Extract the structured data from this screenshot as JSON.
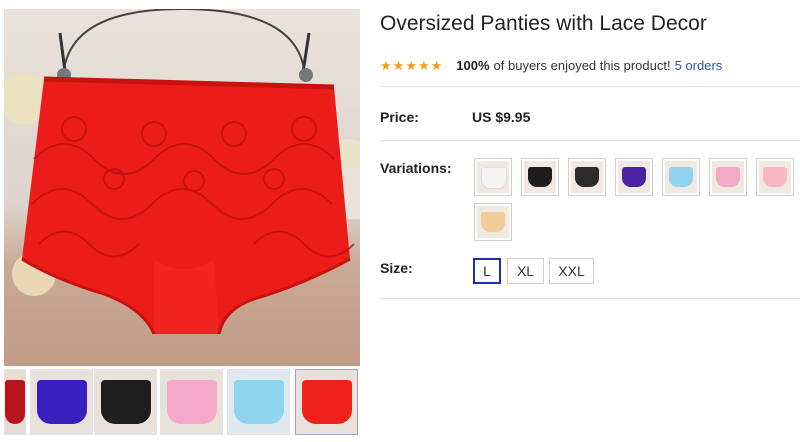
{
  "product": {
    "title": "Oversized Panties with Lace Decor",
    "rating": {
      "stars": 5,
      "percent_text": "100%",
      "enjoyed_text": "of buyers enjoyed this product!",
      "orders_text": "5 orders"
    },
    "price": {
      "label": "Price:",
      "value": "US $9.95"
    },
    "variations": {
      "label": "Variations:",
      "options": [
        {
          "color": "white",
          "hex": "#f4f4f4"
        },
        {
          "color": "black",
          "hex": "#1c1c1c"
        },
        {
          "color": "black-lace",
          "hex": "#2a2a2a"
        },
        {
          "color": "purple",
          "hex": "#4b22a6"
        },
        {
          "color": "light-blue",
          "hex": "#8fd3ec"
        },
        {
          "color": "pink",
          "hex": "#f3a9c7"
        },
        {
          "color": "light-pink",
          "hex": "#f7b7c5"
        },
        {
          "color": "beige",
          "hex": "#f2cb9c"
        }
      ]
    },
    "size": {
      "label": "Size:",
      "options": [
        "L",
        "XL",
        "XXL"
      ],
      "selected": "L"
    }
  },
  "gallery": {
    "main_image": "red lace panties on hanger",
    "thumbnails": [
      {
        "name": "red-partial",
        "hex": "#b8141b"
      },
      {
        "name": "blue",
        "hex": "#3a1fbf"
      },
      {
        "name": "black",
        "hex": "#1e1e1e"
      },
      {
        "name": "multicolor",
        "hex": "#f3a9c7"
      },
      {
        "name": "assorted",
        "hex": "#8fd3ec"
      },
      {
        "name": "red",
        "hex": "#f0201c"
      }
    ],
    "active_thumbnail": 5
  }
}
